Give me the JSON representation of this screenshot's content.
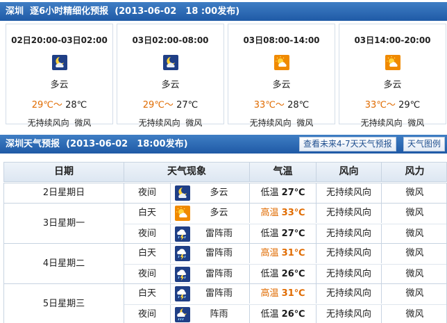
{
  "header1": {
    "city": "深圳",
    "title": "逐6小时精细化预报",
    "issued": "(2013-06-02　18 :00发布)"
  },
  "periods": [
    {
      "time": "02日20:00-03日02:00",
      "icon": "moon-cloud-icon",
      "desc": "多云",
      "high": "29",
      "low": "28",
      "wind": "无持续风向",
      "force": "微风"
    },
    {
      "time": "03日02:00-08:00",
      "icon": "moon-cloud-icon",
      "desc": "多云",
      "high": "29",
      "low": "27",
      "wind": "无持续风向",
      "force": "微风"
    },
    {
      "time": "03日08:00-14:00",
      "icon": "sun-cloud-icon",
      "desc": "多云",
      "high": "33",
      "low": "28",
      "wind": "无持续风向",
      "force": "微风"
    },
    {
      "time": "03日14:00-20:00",
      "icon": "sun-cloud-icon",
      "desc": "多云",
      "high": "33",
      "low": "29",
      "wind": "无持续风向",
      "force": "微风"
    }
  ],
  "units": {
    "deg": "℃",
    "tilde": "～"
  },
  "header2": {
    "city": "深圳",
    "title": "天气预报",
    "issued": "(2013-06-02　18:00发布)"
  },
  "buttons": {
    "more": "查看未来4-7天天气预报",
    "legend": "天气图例"
  },
  "table": {
    "headers": {
      "date": "日期",
      "weather": "天气现象",
      "temp": "气温",
      "wind_dir": "风向",
      "wind_force": "风力"
    },
    "labels": {
      "day": "白天",
      "night": "夜间",
      "high": "高温",
      "low": "低温"
    },
    "days": [
      {
        "date": "2日星期日",
        "rows": [
          {
            "part": "夜间",
            "icon": "moon-cloud-icon",
            "weather": "多云",
            "temp_label": "低温",
            "temp": "27℃",
            "temp_kind": "low",
            "wind_dir": "无持续风向",
            "wind_force": "微风"
          }
        ]
      },
      {
        "date": "3日星期一",
        "rows": [
          {
            "part": "白天",
            "icon": "sun-cloud-icon",
            "weather": "多云",
            "temp_label": "高温",
            "temp": "33℃",
            "temp_kind": "high",
            "wind_dir": "无持续风向",
            "wind_force": "微风"
          },
          {
            "part": "夜间",
            "icon": "thunder-rain-icon",
            "weather": "雷阵雨",
            "temp_label": "低温",
            "temp": "27℃",
            "temp_kind": "low",
            "wind_dir": "无持续风向",
            "wind_force": "微风"
          }
        ]
      },
      {
        "date": "4日星期二",
        "rows": [
          {
            "part": "白天",
            "icon": "thunder-rain-icon",
            "weather": "雷阵雨",
            "temp_label": "高温",
            "temp": "31℃",
            "temp_kind": "high",
            "wind_dir": "无持续风向",
            "wind_force": "微风"
          },
          {
            "part": "夜间",
            "icon": "thunder-rain-icon",
            "weather": "雷阵雨",
            "temp_label": "低温",
            "temp": "26℃",
            "temp_kind": "low",
            "wind_dir": "无持续风向",
            "wind_force": "微风"
          }
        ]
      },
      {
        "date": "5日星期三",
        "rows": [
          {
            "part": "白天",
            "icon": "thunder-rain-icon",
            "weather": "雷阵雨",
            "temp_label": "高温",
            "temp": "31℃",
            "temp_kind": "high",
            "wind_dir": "无持续风向",
            "wind_force": "微风"
          },
          {
            "part": "夜间",
            "icon": "moon-rain-icon",
            "weather": "阵雨",
            "temp_label": "低温",
            "temp": "26℃",
            "temp_kind": "low",
            "wind_dir": "无持续风向",
            "wind_force": "微风"
          }
        ]
      }
    ]
  },
  "colors": {
    "header_blue": "#2a66b3",
    "high_temp": "#e06b00",
    "icon_day_bg": "#f08a00",
    "icon_night_bg": "#1f3f86"
  }
}
